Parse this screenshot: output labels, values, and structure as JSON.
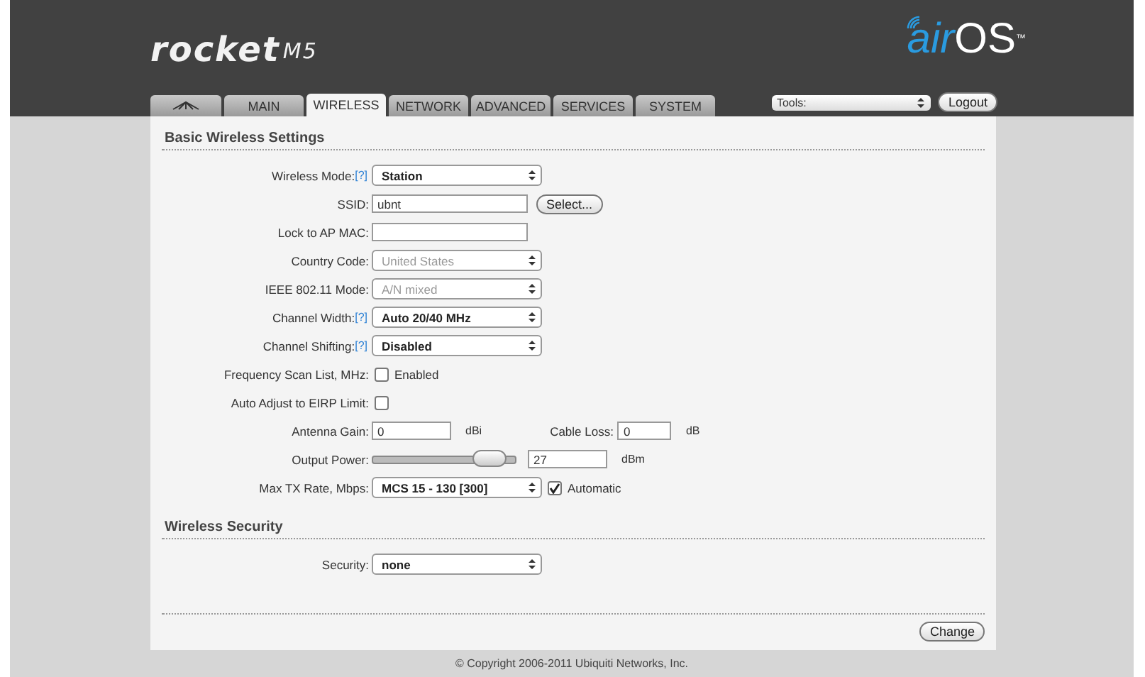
{
  "logo": {
    "product": "rocket",
    "model": "M5"
  },
  "brand": {
    "prefix": "air",
    "name": "OS",
    "mark": "™"
  },
  "tabs": [
    {
      "kind": "icon",
      "selected": false
    },
    {
      "kind": "text",
      "label": "MAIN",
      "selected": false
    },
    {
      "kind": "text",
      "label": "WIRELESS",
      "selected": true
    },
    {
      "kind": "text",
      "label": "NETWORK",
      "selected": false
    },
    {
      "kind": "text",
      "label": "ADVANCED",
      "selected": false
    },
    {
      "kind": "text",
      "label": "SERVICES",
      "selected": false
    },
    {
      "kind": "text",
      "label": "SYSTEM",
      "selected": false
    }
  ],
  "tools": {
    "value": "Tools:",
    "logout": "Logout"
  },
  "sections": [
    {
      "title": "Basic Wireless Settings",
      "rows": [
        {
          "kind": "select",
          "label": "Wireless Mode:",
          "help": "[?]",
          "value": "Station",
          "disabled": false
        },
        {
          "kind": "text",
          "label": "SSID:",
          "value": "ubnt",
          "button": "Select..."
        },
        {
          "kind": "text",
          "label": "Lock to AP MAC:"
        },
        {
          "kind": "select",
          "label": "Country Code:",
          "value": "United States",
          "disabled": true
        },
        {
          "kind": "select",
          "label": "IEEE 802.11 Mode:",
          "value": "A/N mixed",
          "disabled": true
        },
        {
          "kind": "select",
          "label": "Channel Width:",
          "help": "[?]",
          "value": "Auto 20/40 MHz",
          "disabled": false
        },
        {
          "kind": "select",
          "label": "Channel Shifting:",
          "help": "[?]",
          "value": "Disabled",
          "disabled": false
        },
        {
          "kind": "checkbox",
          "label": "Frequency Scan List, MHz:",
          "checked": false,
          "text": "Enabled"
        },
        {
          "kind": "checkbox",
          "label": "Auto Adjust to EIRP Limit:",
          "checked": false
        },
        {
          "kind": "pair",
          "label": "Antenna Gain:",
          "value": "0",
          "unit": "dBi",
          "label2": "Cable Loss:",
          "value2": "0",
          "unit2": "dB"
        },
        {
          "kind": "slider",
          "label": "Output Power:",
          "level": 0.92,
          "value": "27",
          "unit": "dBm"
        },
        {
          "kind": "select",
          "label": "Max TX Rate, Mbps:",
          "value": "MCS 15 - 130 [300]",
          "disabled": false,
          "checked": true,
          "text": "Automatic"
        }
      ]
    },
    {
      "title": "Wireless Security",
      "rows": [
        {
          "kind": "select",
          "label": "Security:",
          "value": "none",
          "disabled": false
        }
      ]
    }
  ],
  "change_button": "Change",
  "footer": "© Copyright 2006-2011 Ubiquiti Networks, Inc."
}
